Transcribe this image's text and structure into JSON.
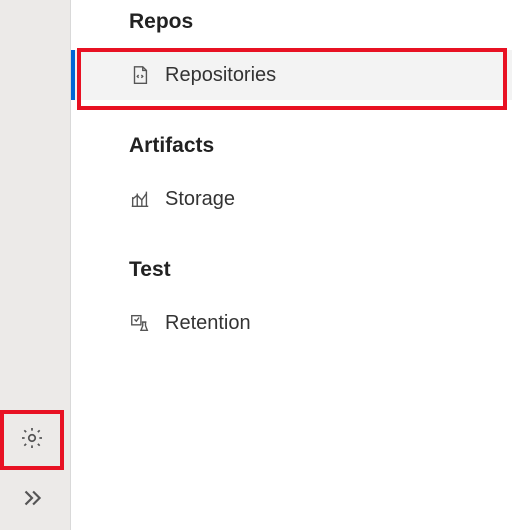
{
  "sidebar": {
    "sections": [
      {
        "header": "Repos",
        "items": [
          {
            "label": "Repositories",
            "icon": "repo-file-icon",
            "selected": true
          }
        ]
      },
      {
        "header": "Artifacts",
        "items": [
          {
            "label": "Storage",
            "icon": "storage-chart-icon",
            "selected": false
          }
        ]
      },
      {
        "header": "Test",
        "items": [
          {
            "label": "Retention",
            "icon": "retention-flask-icon",
            "selected": false
          }
        ]
      }
    ]
  },
  "rail": {
    "gear_label": "Settings",
    "expand_label": "Expand"
  },
  "highlights": {
    "gear": true,
    "repositories": true
  }
}
